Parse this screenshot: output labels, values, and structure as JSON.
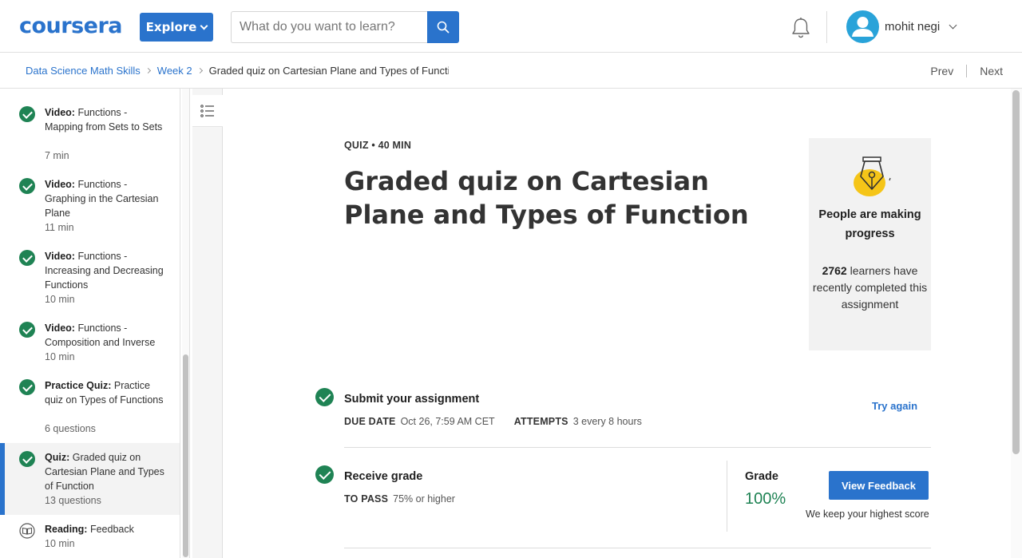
{
  "header": {
    "logo": "coursera",
    "explore_label": "Explore",
    "search_placeholder": "What do you want to learn?",
    "user_name": "mohit negi",
    "brand_color": "#2a73cc"
  },
  "breadcrumb": {
    "items": [
      "Data Science Math Skills",
      "Week 2"
    ],
    "current": "Graded quiz on Cartesian Plane and Types of Functior",
    "prev": "Prev",
    "next": "Next"
  },
  "sidebar": {
    "items": [
      {
        "type": "Video:",
        "title": "Functions - Mapping from Sets to Sets",
        "meta": "7 min",
        "status": "completed"
      },
      {
        "type": "Video:",
        "title": "Functions - Graphing in the Cartesian Plane",
        "meta": "11 min",
        "status": "completed"
      },
      {
        "type": "Video:",
        "title": "Functions - Increasing and Decreasing Functions",
        "meta": "10 min",
        "status": "completed"
      },
      {
        "type": "Video:",
        "title": "Functions - Composition and Inverse",
        "meta": "10 min",
        "status": "completed"
      },
      {
        "type": "Practice Quiz:",
        "title": "Practice quiz on Types of Functions",
        "meta": "6 questions",
        "status": "completed"
      },
      {
        "type": "Quiz:",
        "title": "Graded quiz on Cartesian Plane and Types of Function",
        "meta": "13 questions",
        "status": "completed",
        "active": true
      },
      {
        "type": "Reading:",
        "title": "Feedback",
        "meta": "10 min",
        "status": "reading"
      }
    ]
  },
  "main": {
    "quiz_meta": "QUIZ • 40 MIN",
    "title": "Graded quiz on Cartesian Plane and Types of Function",
    "progress_card": {
      "heading": "People are making progress",
      "count": "2762",
      "body": " learners have recently completed this assignment"
    },
    "submit": {
      "title": "Submit your assignment",
      "due_label": "DUE DATE",
      "due_value": "Oct 26, 7:59 AM CET",
      "attempts_label": "ATTEMPTS",
      "attempts_value": "3 every 8 hours",
      "action": "Try again"
    },
    "receive": {
      "title": "Receive grade",
      "pass_label": "TO PASS",
      "pass_value": "75% or higher",
      "grade_label": "Grade",
      "grade_value": "100%",
      "action": "View Feedback",
      "note": "We keep your highest score"
    }
  },
  "colors": {
    "success": "#1f8354",
    "accent": "#2a73cc",
    "card_bg": "#f2f2f2"
  }
}
